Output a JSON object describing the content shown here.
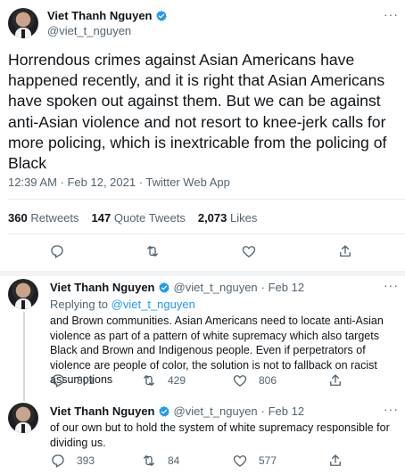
{
  "main": {
    "author": {
      "name": "Viet Thanh Nguyen",
      "handle": "@viet_t_nguyen"
    },
    "text": "Horrendous crimes against Asian Americans have happened recently, and it is right that Asian Americans have spoken out against them. But we can be against anti-Asian violence and not resort to knee-jerk calls for more policing, which is inextricable from the policing of Black",
    "meta": "12:39 AM · Feb 12, 2021 · Twitter Web App",
    "stats": {
      "retweets_count": "360",
      "retweets_label": "Retweets",
      "quotes_count": "147",
      "quotes_label": "Quote Tweets",
      "likes_count": "2,073",
      "likes_label": "Likes"
    }
  },
  "replies": [
    {
      "author": {
        "name": "Viet Thanh Nguyen",
        "handle": "@viet_t_nguyen"
      },
      "date": "· Feb 12",
      "replying_prefix": "Replying to",
      "replying_to": "@viet_t_nguyen",
      "text": "and Brown communities. Asian Americans need to locate anti-Asian violence as part of a pattern of white supremacy which also targets Black and Brown and Indigenous people. Even if perpetrators of violence are people of color, the solution is not to fallback on racist assumptions",
      "reply_count": "801",
      "retweet_count": "429",
      "like_count": "806"
    },
    {
      "author": {
        "name": "Viet Thanh Nguyen",
        "handle": "@viet_t_nguyen"
      },
      "date": "· Feb 12",
      "text": "of our own but to hold the system of white supremacy responsible for dividing us.",
      "reply_count": "393",
      "retweet_count": "84",
      "like_count": "577"
    }
  ],
  "icons": {
    "more": "more-icon",
    "verified": "verified-badge-icon",
    "reply": "reply-icon",
    "retweet": "retweet-icon",
    "like": "heart-icon",
    "share": "share-icon"
  },
  "colors": {
    "accent": "#1d9bf0",
    "secondary_text": "#536471",
    "divider": "#e6ecf0"
  }
}
